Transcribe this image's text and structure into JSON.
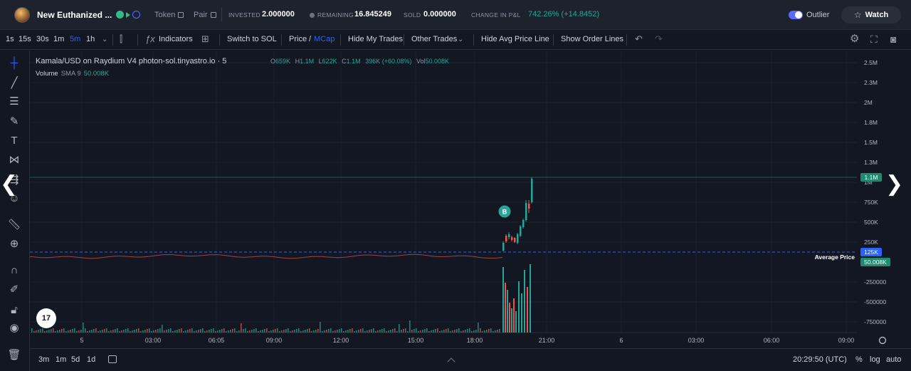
{
  "header": {
    "token_name": "New Euthanized ...",
    "token_link": "Token",
    "pair_link": "Pair",
    "invested_label": "INVESTED",
    "invested_value": "2.000000",
    "remaining_label": "REMAINING",
    "remaining_value": "16.845249",
    "sold_label": "SOLD",
    "sold_value": "0.000000",
    "pnl_label": "CHANGE IN P&L",
    "pnl_value": "742.26% (+14.8452)",
    "outlier_label": "Outlier",
    "outlier_on": true,
    "watch_label": "Watch"
  },
  "toolbar": {
    "intervals": [
      "1s",
      "15s",
      "30s",
      "1m",
      "5m",
      "1h"
    ],
    "active_interval": "5m",
    "indicators_label": "Indicators",
    "switch_label": "Switch to SOL",
    "price_label": "Price",
    "price_sep": "/",
    "mcap_label": "MCap",
    "hide_my_trades_label": "Hide My Trades",
    "other_trades_label": "Other Trades",
    "hide_avg_label": "Hide Avg Price Line",
    "show_order_label": "Show Order Lines"
  },
  "left_tools": [
    "crosshair-icon",
    "trend-line-icon",
    "fib-icon",
    "brush-icon",
    "text-icon",
    "pattern-icon",
    "forecast-icon",
    "emoji-icon",
    "ruler-icon",
    "zoom-in-icon",
    "magnet-icon",
    "lock-drawing-icon",
    "unlock-icon",
    "eye-icon",
    "trash-icon"
  ],
  "chart": {
    "legend_title": "Kamala/USD on Raydium V4 photon-sol.tinyastro.io · 5",
    "ohlc_o_label": "O",
    "ohlc_o": "659K",
    "ohlc_h_label": "H",
    "ohlc_h": "1.1M",
    "ohlc_l_label": "L",
    "ohlc_l": "622K",
    "ohlc_c_label": "C",
    "ohlc_c": "1.1M",
    "ohlc_change": "396K (+60.08%)",
    "vol_label": "Vol",
    "vol_value": "50.008K",
    "volume_label": "Volume",
    "volume_sma": "SMA 9",
    "volume_sma_value": "50.008K",
    "y_ticks": [
      "2.5M",
      "2.3M",
      "2M",
      "1.8M",
      "1.5M",
      "1.3M",
      "1M",
      "750K",
      "500K",
      "250K",
      "-250000",
      "-500000",
      "-750000"
    ],
    "x_ticks": [
      "5",
      "03:00",
      "06:05",
      "09:00",
      "12:00",
      "15:00",
      "18:00",
      "21:00",
      "6",
      "03:00",
      "06:00",
      "09:00"
    ],
    "current_price_badge": "1.1M",
    "avg_price_badge": "125K",
    "avg_price_label": "Average Price",
    "volume_badge": "50.008K",
    "buy_marker": "B",
    "tv_logo": "17",
    "colors": {
      "up": "#26a69a",
      "down": "#ef5350",
      "avg_line": "#2962ff",
      "bg": "#131722"
    }
  },
  "bottom": {
    "ranges": [
      "3m",
      "1m",
      "5d",
      "1d"
    ],
    "clock": "20:29:50 (UTC)",
    "percent_label": "%",
    "log_label": "log",
    "auto_label": "auto"
  }
}
